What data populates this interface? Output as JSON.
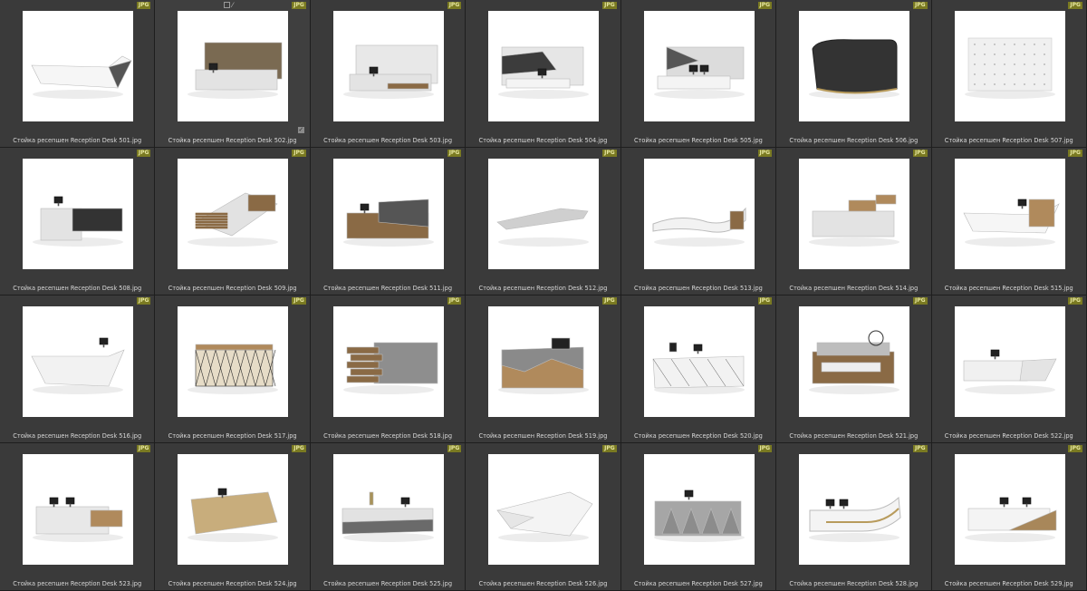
{
  "badge_label": "JPG",
  "selected_index": 1,
  "items": [
    {
      "file": "Стойка ресепшен Reception Desk 501.jpg",
      "variant": "wedge"
    },
    {
      "file": "Стойка ресепшен Reception Desk 502.jpg",
      "variant": "wall-wood"
    },
    {
      "file": "Стойка ресепшен Reception Desk 503.jpg",
      "variant": "wall-marble"
    },
    {
      "file": "Стойка ресепшен Reception Desk 504.jpg",
      "variant": "wall-dark"
    },
    {
      "file": "Стойка ресепшен Reception Desk 505.jpg",
      "variant": "wall-marble2"
    },
    {
      "file": "Стойка ресепшен Reception Desk 506.jpg",
      "variant": "curve-dark"
    },
    {
      "file": "Стойка ресепшен Reception Desk 507.jpg",
      "variant": "tufted"
    },
    {
      "file": "Стойка ресепшен Reception Desk 508.jpg",
      "variant": "marble-black"
    },
    {
      "file": "Стойка ресепшен Reception Desk 509.jpg",
      "variant": "slope-wood"
    },
    {
      "file": "Стойка ресепшен Reception Desk 511.jpg",
      "variant": "wood-concrete"
    },
    {
      "file": "Стойка ресепшен Reception Desk 512.jpg",
      "variant": "blade"
    },
    {
      "file": "Стойка ресепшен Reception Desk 513.jpg",
      "variant": "wave"
    },
    {
      "file": "Стойка ресепшен Reception Desk 514.jpg",
      "variant": "marble-wood"
    },
    {
      "file": "Стойка ресепшен Reception Desk 515.jpg",
      "variant": "wedge-wood"
    },
    {
      "file": "Стойка ресепшен Reception Desk 516.jpg",
      "variant": "white-wedge"
    },
    {
      "file": "Стойка ресепшен Reception Desk 517.jpg",
      "variant": "lattice"
    },
    {
      "file": "Стойка ресепшен Reception Desk 518.jpg",
      "variant": "stack-concrete"
    },
    {
      "file": "Стойка ресепшен Reception Desk 519.jpg",
      "variant": "wood-concrete2"
    },
    {
      "file": "Стойка ресепшен Reception Desk 520.jpg",
      "variant": "faceted"
    },
    {
      "file": "Стойка ресепшен Reception Desk 521.jpg",
      "variant": "wood-layers"
    },
    {
      "file": "Стойка ресепшен Reception Desk 522.jpg",
      "variant": "white-long"
    },
    {
      "file": "Стойка ресепшен Reception Desk 523.jpg",
      "variant": "marble-two"
    },
    {
      "file": "Стойка ресепшен Reception Desk 524.jpg",
      "variant": "wood-block"
    },
    {
      "file": "Стойка ресепшен Reception Desk 525.jpg",
      "variant": "marble-long"
    },
    {
      "file": "Стойка ресепшен Reception Desk 526.jpg",
      "variant": "white-facet"
    },
    {
      "file": "Стойка ресепшен Reception Desk 527.jpg",
      "variant": "concrete-block"
    },
    {
      "file": "Стойка ресепшен Reception Desk 528.jpg",
      "variant": "white-curve"
    },
    {
      "file": "Стойка ресепшен Reception Desk 529.jpg",
      "variant": "white-wood"
    }
  ]
}
